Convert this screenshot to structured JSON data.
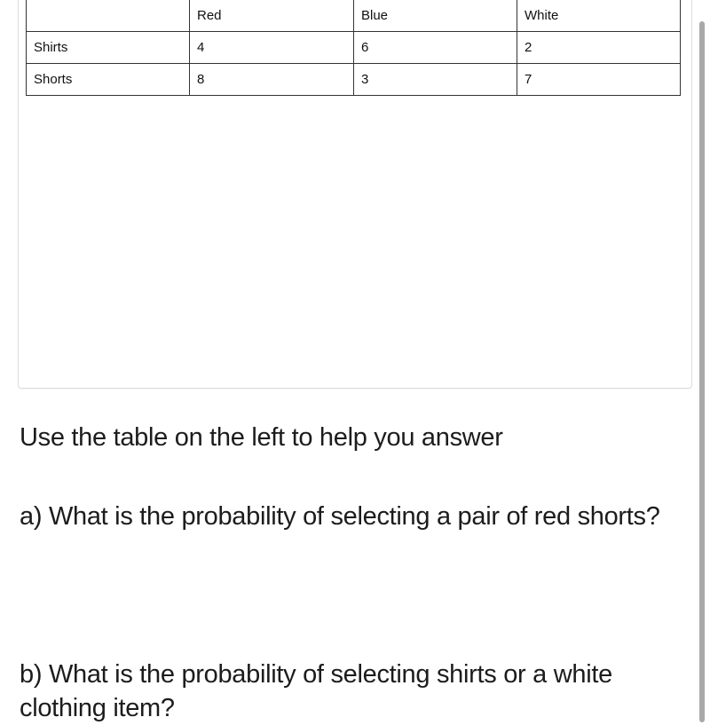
{
  "table": {
    "header": [
      "",
      "Red",
      "Blue",
      "White"
    ],
    "rows": [
      {
        "label": "Shirts",
        "values": [
          "4",
          "6",
          "2"
        ]
      },
      {
        "label": "Shorts",
        "values": [
          "8",
          "3",
          "7"
        ]
      }
    ]
  },
  "questions": {
    "intro": "Use the table on the left to help you answer",
    "a": "a) What is the probability of selecting a pair of red shorts?",
    "b": "b) What is the probability of selecting shirts or a white clothing item?"
  }
}
